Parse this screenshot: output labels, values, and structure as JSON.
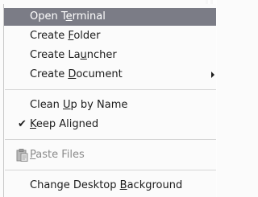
{
  "menu": {
    "items": [
      {
        "pre": "Open T",
        "u": "e",
        "post": "rminal",
        "state": "selected"
      },
      {
        "pre": "Create ",
        "u": "F",
        "post": "older",
        "state": "normal"
      },
      {
        "pre": "Create La",
        "u": "u",
        "post": "ncher",
        "state": "normal"
      },
      {
        "pre": "Create ",
        "u": "D",
        "post": "ocument",
        "state": "normal",
        "submenu": true
      },
      {
        "pre": "Clean ",
        "u": "U",
        "post": "p by Name",
        "state": "normal"
      },
      {
        "pre": "",
        "u": "K",
        "post": "eep Aligned",
        "state": "checked"
      },
      {
        "pre": "",
        "u": "P",
        "post": "aste Files",
        "state": "disabled",
        "icon": "paste-icon"
      },
      {
        "pre": "Change Desktop ",
        "u": "B",
        "post": "ackground",
        "state": "normal"
      }
    ],
    "check_glyph": "✔"
  }
}
